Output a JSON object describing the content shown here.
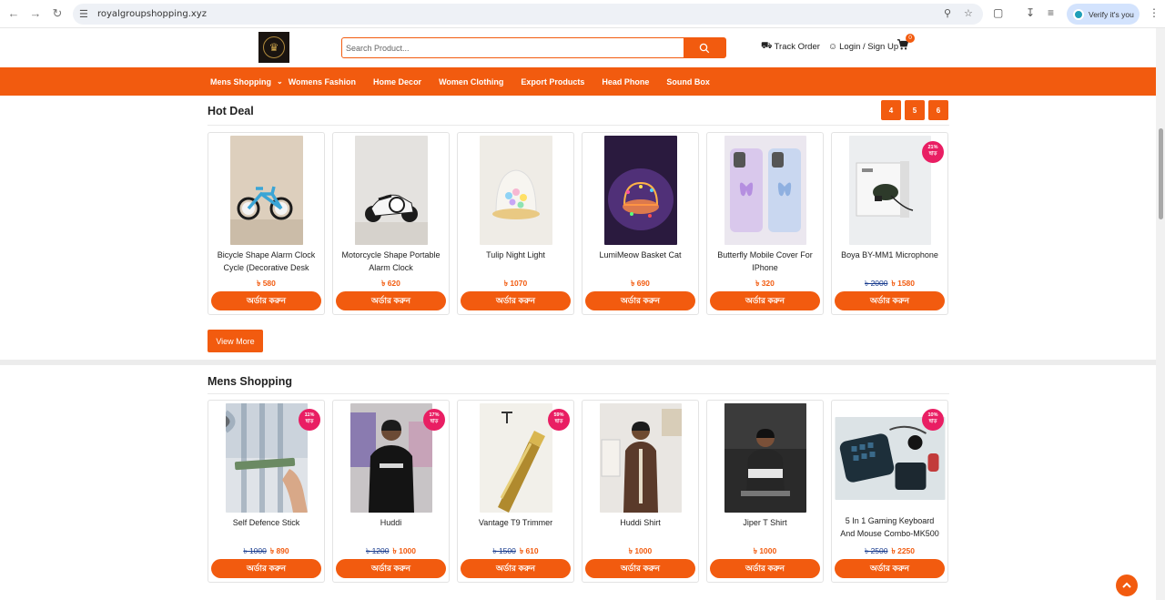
{
  "browser": {
    "url": "royalgroupshopping.xyz",
    "verify_label": "Verify it's you"
  },
  "header": {
    "search_placeholder": "Search Product...",
    "track_order": "Track Order",
    "login": "Login / Sign Up",
    "cart_count": "0"
  },
  "nav": {
    "items": [
      "Mens Shopping",
      "Womens Fashion",
      "Home Decor",
      "Women Clothing",
      "Export Products",
      "Head Phone",
      "Sound Box"
    ]
  },
  "hot_deal": {
    "title": "Hot Deal",
    "pages": [
      "4",
      "5",
      "6"
    ],
    "view_more": "View More",
    "products": [
      {
        "name": "Bicycle Shape Alarm Clock Cycle (Decorative Desk",
        "old_price": "",
        "price": "৳ 580",
        "discount": "",
        "order": "অর্ডার করুন"
      },
      {
        "name": "Motorcycle Shape Portable Alarm Clock",
        "old_price": "",
        "price": "৳ 620",
        "discount": "",
        "order": "অর্ডার করুন"
      },
      {
        "name": "Tulip Night Light",
        "old_price": "",
        "price": "৳ 1070",
        "discount": "",
        "order": "অর্ডার করুন"
      },
      {
        "name": "LumiMeow Basket Cat",
        "old_price": "",
        "price": "৳ 690",
        "discount": "",
        "order": "অর্ডার করুন"
      },
      {
        "name": "Butterfly Mobile Cover For IPhone",
        "old_price": "",
        "price": "৳ 320",
        "discount": "",
        "order": "অর্ডার করুন"
      },
      {
        "name": "Boya BY-MM1 Microphone",
        "old_price": "৳ 2000",
        "price": "৳ 1580",
        "discount": "21% ছাড়",
        "order": "অর্ডার করুন"
      }
    ]
  },
  "mens": {
    "title": "Mens Shopping",
    "products": [
      {
        "name": "Self Defence Stick",
        "old_price": "৳ 1000",
        "price": "৳ 890",
        "discount": "11% ছাড়",
        "order": "অর্ডার করুন"
      },
      {
        "name": "Huddi",
        "old_price": "৳ 1200",
        "price": "৳ 1000",
        "discount": "17% ছাড়",
        "order": "অর্ডার করুন"
      },
      {
        "name": "Vantage T9 Trimmer",
        "old_price": "৳ 1500",
        "price": "৳ 610",
        "discount": "59% ছাড়",
        "order": "অর্ডার করুন"
      },
      {
        "name": "Huddi Shirt",
        "old_price": "",
        "price": "৳ 1000",
        "discount": "",
        "order": "অর্ডার করুন"
      },
      {
        "name": "Jiper T Shirt",
        "old_price": "",
        "price": "৳ 1000",
        "discount": "",
        "order": "অর্ডার করুন"
      },
      {
        "name": "5 In 1 Gaming Keyboard And Mouse Combo-MK500",
        "old_price": "৳ 2500",
        "price": "৳ 2250",
        "discount": "10% ছাড়",
        "order": "অর্ডার করুন"
      }
    ]
  },
  "colors": {
    "accent": "#f25b0f",
    "discount_badge": "#e91e63",
    "old_price": "#1a3d8f"
  }
}
